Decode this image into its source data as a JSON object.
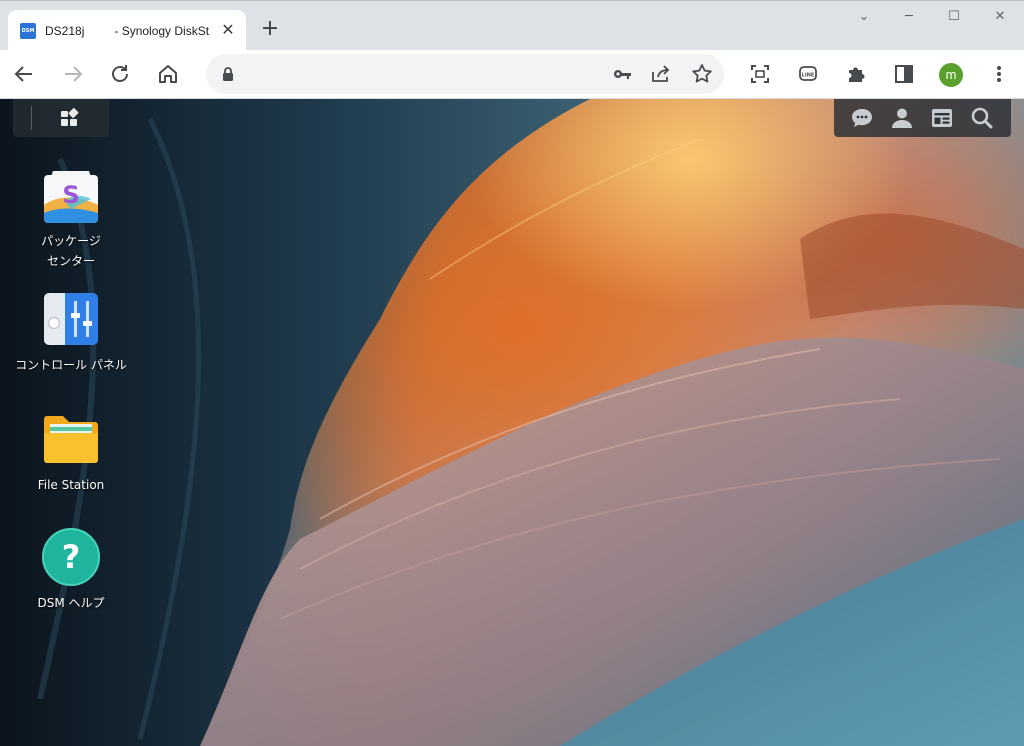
{
  "browser": {
    "tab": {
      "favicon_text": "DSM",
      "title_host": "DS218j",
      "title_text": "- Synology DiskSt"
    },
    "close_glyph": "✕",
    "new_tab_glyph": "+",
    "window": {
      "minimize_glyph": "─",
      "maximize_glyph": "☐",
      "close_glyph": "✕",
      "dropdown_glyph": "⌄"
    },
    "address": {
      "value": "",
      "placeholder": ""
    },
    "profile_initial": "m",
    "colors": {
      "tabbar": "#dee1e6",
      "omnibox": "#f1f3f4",
      "avatar": "#5aa02c",
      "favicon": "#2a74d8"
    }
  },
  "dsm": {
    "apps": [
      {
        "label_line1": "パッケージ",
        "label_line2": "センター",
        "icon": "package-center-icon"
      },
      {
        "label_line1": "コントロール パネル",
        "label_line2": "",
        "icon": "control-panel-icon"
      },
      {
        "label_line1": "File Station",
        "label_line2": "",
        "icon": "file-station-icon"
      },
      {
        "label_line1": "DSM ヘルプ",
        "label_line2": "",
        "icon": "dsm-help-icon"
      }
    ],
    "help_glyph": "?",
    "package_glyph": "S",
    "tray_icons": [
      "chat-icon",
      "user-icon",
      "widgets-icon",
      "search-icon"
    ]
  }
}
